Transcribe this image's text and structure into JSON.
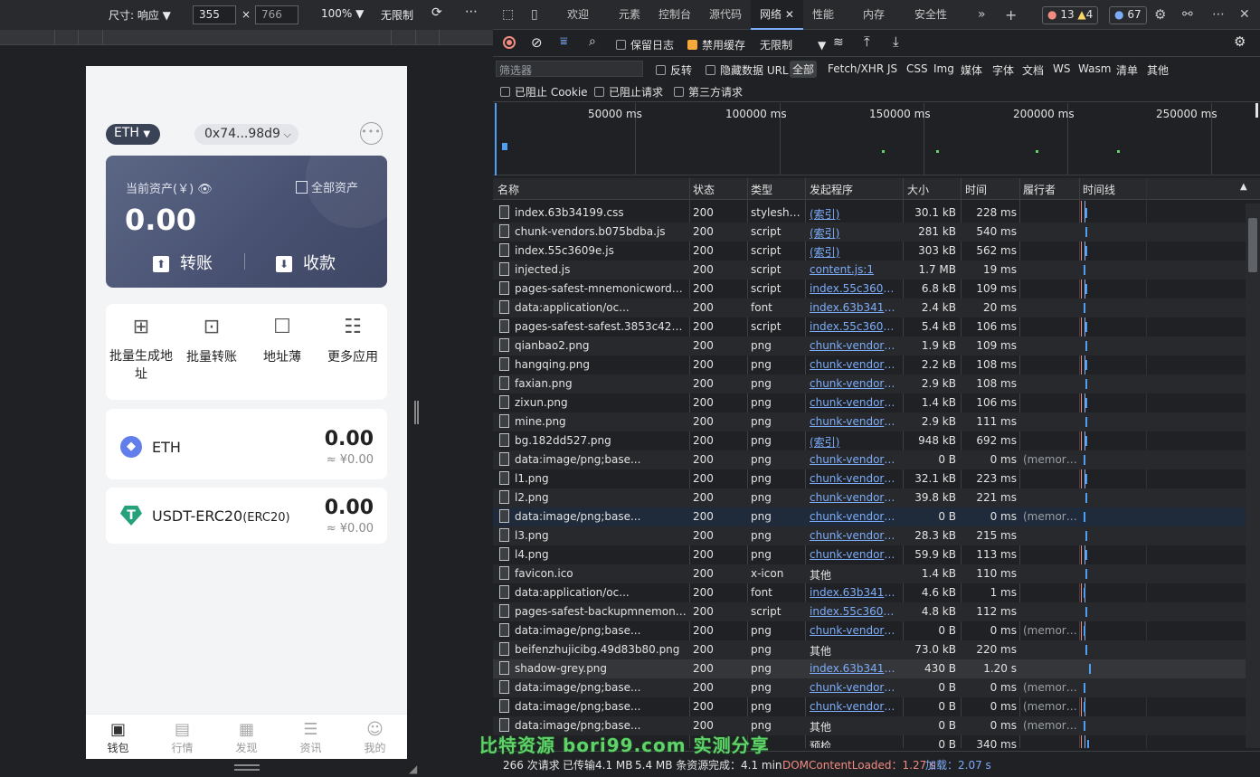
{
  "devicebar": {
    "size_label": "尺寸: 响应",
    "width": "355",
    "height": "766",
    "zoom": "100%",
    "throttle": "无限制"
  },
  "wallet": {
    "chain": "ETH",
    "address": "0x74...98d9",
    "card": {
      "label": "当前资产(￥)",
      "all_assets": "全部资产",
      "balance": "0.00",
      "transfer": "转账",
      "receive": "收款"
    },
    "apps": [
      {
        "label": "批量生成地址"
      },
      {
        "label": "批量转账"
      },
      {
        "label": "地址薄"
      },
      {
        "label": "更多应用"
      }
    ],
    "assets": [
      {
        "name": "ETH",
        "sub": "",
        "amount": "0.00",
        "fiat": "≈ ¥0.00"
      },
      {
        "name": "USDT-ERC20",
        "sub": "(ERC20)",
        "amount": "0.00",
        "fiat": "≈ ¥0.00"
      }
    ],
    "tabs": [
      {
        "label": "钱包"
      },
      {
        "label": "行情"
      },
      {
        "label": "发现"
      },
      {
        "label": "资讯"
      },
      {
        "label": "我的"
      }
    ]
  },
  "devtools": {
    "tabs": [
      {
        "label": "欢迎"
      },
      {
        "label": "元素"
      },
      {
        "label": "控制台"
      },
      {
        "label": "源代码"
      },
      {
        "label": "网络"
      },
      {
        "label": "性能"
      },
      {
        "label": "内存"
      },
      {
        "label": "安全性"
      }
    ],
    "errors": "13",
    "warnings": "4",
    "issues": "67",
    "toolbar": {
      "preserve_log": "保留日志",
      "disable_cache": "禁用缓存",
      "throttle": "无限制"
    },
    "filter": {
      "placeholder": "筛选器",
      "invert": "反转",
      "hide_data_urls": "隐藏数据 URL",
      "types": [
        "全部",
        "Fetch/XHR",
        "JS",
        "CSS",
        "Img",
        "媒体",
        "字体",
        "文档",
        "WS",
        "Wasm",
        "清单",
        "其他"
      ],
      "blocked_cookies": "已阻止 Cookie",
      "blocked_requests": "已阻止请求",
      "third_party": "第三方请求"
    },
    "overview_ticks": [
      "50000 ms",
      "100000 ms",
      "150000 ms",
      "200000 ms",
      "250000 ms"
    ],
    "columns": {
      "name": "名称",
      "status": "状态",
      "type": "类型",
      "initiator": "发起程序",
      "size": "大小",
      "time": "时间",
      "executor": "履行者",
      "waterfall": "时间线"
    },
    "rows": [
      {
        "name": "index.63b34199.css",
        "status": "200",
        "type": "stylesheet",
        "initiator": "(索引)",
        "size": "30.1 kB",
        "time": "228 ms",
        "fulfilled": ""
      },
      {
        "name": "chunk-vendors.b075bdba.js",
        "status": "200",
        "type": "script",
        "initiator": "(索引)",
        "size": "281 kB",
        "time": "540 ms",
        "fulfilled": ""
      },
      {
        "name": "index.55c3609e.js",
        "status": "200",
        "type": "script",
        "initiator": "(索引)",
        "size": "303 kB",
        "time": "562 ms",
        "fulfilled": ""
      },
      {
        "name": "injected.js",
        "status": "200",
        "type": "script",
        "initiator": "content.js:1",
        "size": "1.7 MB",
        "time": "19 ms",
        "fulfilled": ""
      },
      {
        "name": "pages-safest-mnemonicwords-m...",
        "status": "200",
        "type": "script",
        "initiator": "index.55c3609e.j...",
        "size": "6.8 kB",
        "time": "109 ms",
        "fulfilled": ""
      },
      {
        "name": "data:application/oc...",
        "status": "200",
        "type": "font",
        "initiator": "index.63b34199....",
        "size": "2.4 kB",
        "time": "20 ms",
        "fulfilled": ""
      },
      {
        "name": "pages-safest-safest.3853c42a.js",
        "status": "200",
        "type": "script",
        "initiator": "index.55c3609e.j...",
        "size": "5.4 kB",
        "time": "106 ms",
        "fulfilled": ""
      },
      {
        "name": "qianbao2.png",
        "status": "200",
        "type": "png",
        "initiator": "chunk-vendors.b...",
        "size": "1.9 kB",
        "time": "109 ms",
        "fulfilled": ""
      },
      {
        "name": "hangqing.png",
        "status": "200",
        "type": "png",
        "initiator": "chunk-vendors.b...",
        "size": "2.2 kB",
        "time": "108 ms",
        "fulfilled": ""
      },
      {
        "name": "faxian.png",
        "status": "200",
        "type": "png",
        "initiator": "chunk-vendors.b...",
        "size": "2.9 kB",
        "time": "108 ms",
        "fulfilled": ""
      },
      {
        "name": "zixun.png",
        "status": "200",
        "type": "png",
        "initiator": "chunk-vendors.b...",
        "size": "1.4 kB",
        "time": "106 ms",
        "fulfilled": ""
      },
      {
        "name": "mine.png",
        "status": "200",
        "type": "png",
        "initiator": "chunk-vendors.b...",
        "size": "2.9 kB",
        "time": "111 ms",
        "fulfilled": ""
      },
      {
        "name": "bg.182dd527.png",
        "status": "200",
        "type": "png",
        "initiator": "(索引)",
        "size": "948 kB",
        "time": "692 ms",
        "fulfilled": ""
      },
      {
        "name": "data:image/png;base...",
        "status": "200",
        "type": "png",
        "initiator": "chunk-vendors.b...",
        "size": "0 B",
        "time": "0 ms",
        "fulfilled": "(memory..."
      },
      {
        "name": "l1.png",
        "status": "200",
        "type": "png",
        "initiator": "chunk-vendors.b...",
        "size": "32.1 kB",
        "time": "223 ms",
        "fulfilled": ""
      },
      {
        "name": "l2.png",
        "status": "200",
        "type": "png",
        "initiator": "chunk-vendors.b...",
        "size": "39.8 kB",
        "time": "221 ms",
        "fulfilled": ""
      },
      {
        "name": "data:image/png;base...",
        "status": "200",
        "type": "png",
        "initiator": "chunk-vendors.b...",
        "size": "0 B",
        "time": "0 ms",
        "fulfilled": "(memory..."
      },
      {
        "name": "l3.png",
        "status": "200",
        "type": "png",
        "initiator": "chunk-vendors.b...",
        "size": "28.3 kB",
        "time": "215 ms",
        "fulfilled": ""
      },
      {
        "name": "l4.png",
        "status": "200",
        "type": "png",
        "initiator": "chunk-vendors.b...",
        "size": "59.9 kB",
        "time": "113 ms",
        "fulfilled": ""
      },
      {
        "name": "favicon.ico",
        "status": "200",
        "type": "x-icon",
        "initiator": "其他",
        "size": "1.4 kB",
        "time": "110 ms",
        "fulfilled": ""
      },
      {
        "name": "data:application/oc...",
        "status": "200",
        "type": "font",
        "initiator": "index.63b34199....",
        "size": "4.6 kB",
        "time": "1 ms",
        "fulfilled": ""
      },
      {
        "name": "pages-safest-backupmnemonic-b...",
        "status": "200",
        "type": "script",
        "initiator": "index.55c3609e.j...",
        "size": "4.8 kB",
        "time": "112 ms",
        "fulfilled": ""
      },
      {
        "name": "data:image/png;base...",
        "status": "200",
        "type": "png",
        "initiator": "chunk-vendors.b...",
        "size": "0 B",
        "time": "0 ms",
        "fulfilled": "(memory..."
      },
      {
        "name": "beifenzhujicibg.49d83b80.png",
        "status": "200",
        "type": "png",
        "initiator": "其他",
        "size": "73.0 kB",
        "time": "220 ms",
        "fulfilled": ""
      },
      {
        "name": "shadow-grey.png",
        "status": "200",
        "type": "png",
        "initiator": "index.63b34199....",
        "size": "430 B",
        "time": "1.20 s",
        "fulfilled": ""
      },
      {
        "name": "data:image/png;base...",
        "status": "200",
        "type": "png",
        "initiator": "chunk-vendors.b...",
        "size": "0 B",
        "time": "0 ms",
        "fulfilled": "(memory..."
      },
      {
        "name": "data:image/png;base...",
        "status": "200",
        "type": "png",
        "initiator": "chunk-vendors.b...",
        "size": "0 B",
        "time": "0 ms",
        "fulfilled": "(memory..."
      },
      {
        "name": "data:image/png;base...",
        "status": "200",
        "type": "png",
        "initiator": "其他",
        "size": "0 B",
        "time": "0 ms",
        "fulfilled": "(memory..."
      },
      {
        "name": "",
        "status": "",
        "type": "",
        "initiator": "预检",
        "size": "0 B",
        "time": "340 ms",
        "fulfilled": ""
      }
    ],
    "status": {
      "requests": "266 次请求",
      "transferred": "已传输4.1 MB",
      "resources": "5.4 MB 条资源",
      "finish": "完成：4.1 min",
      "dcl": "DOMContentLoaded：1.27 s",
      "load": "加载：2.07 s"
    }
  },
  "watermark": "比特资源 bori99.com 实测分享"
}
